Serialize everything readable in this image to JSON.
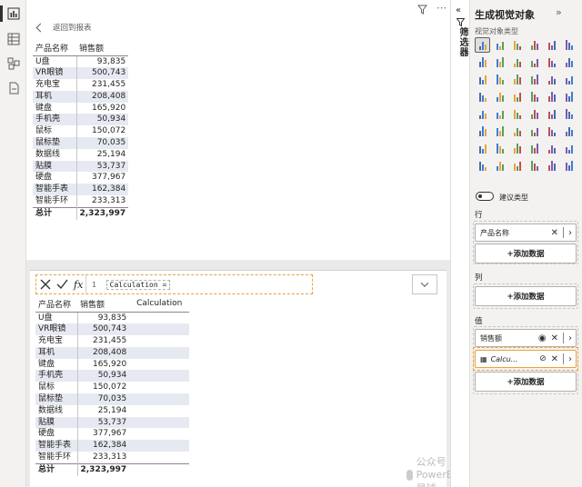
{
  "back_link": "返回到报表",
  "table1": {
    "headers": [
      "产品名称",
      "销售额"
    ],
    "rows": [
      [
        "U盘",
        "93,835"
      ],
      [
        "VR眼镜",
        "500,743"
      ],
      [
        "充电宝",
        "231,455"
      ],
      [
        "耳机",
        "208,408"
      ],
      [
        "键盘",
        "165,920"
      ],
      [
        "手机壳",
        "50,934"
      ],
      [
        "鼠标",
        "150,072"
      ],
      [
        "鼠标垫",
        "70,035"
      ],
      [
        "数据线",
        "25,194"
      ],
      [
        "贴膜",
        "53,737"
      ],
      [
        "硬盘",
        "377,967"
      ],
      [
        "智能手表",
        "162,384"
      ],
      [
        "智能手环",
        "233,313"
      ]
    ],
    "total": [
      "总计",
      "2,323,997"
    ]
  },
  "formula": {
    "line_no": "1",
    "expression": "Calculation ="
  },
  "table2": {
    "headers": [
      "产品名称",
      "销售额",
      "Calculation"
    ],
    "rows": [
      [
        "U盘",
        "93,835",
        ""
      ],
      [
        "VR眼镜",
        "500,743",
        ""
      ],
      [
        "充电宝",
        "231,455",
        ""
      ],
      [
        "耳机",
        "208,408",
        ""
      ],
      [
        "键盘",
        "165,920",
        ""
      ],
      [
        "手机壳",
        "50,934",
        ""
      ],
      [
        "鼠标",
        "150,072",
        ""
      ],
      [
        "鼠标垫",
        "70,035",
        ""
      ],
      [
        "数据线",
        "25,194",
        ""
      ],
      [
        "贴膜",
        "53,737",
        ""
      ],
      [
        "硬盘",
        "377,967",
        ""
      ],
      [
        "智能手表",
        "162,384",
        ""
      ],
      [
        "智能手环",
        "233,313",
        ""
      ]
    ],
    "total": [
      "总计",
      "2,323,997",
      ""
    ]
  },
  "filter_label": "筛选器",
  "viz_pane": {
    "title": "生成视觉对象",
    "subtitle": "视觉对象类型",
    "suggest_label": "建议类型",
    "rows_label": "行",
    "rows_field": "产品名称",
    "add_data": "+添加数据",
    "cols_label": "列",
    "values_label": "值",
    "value_field1": "销售额",
    "value_field2": "Calcu..."
  },
  "watermark": "公众号 · PowerBI星球"
}
